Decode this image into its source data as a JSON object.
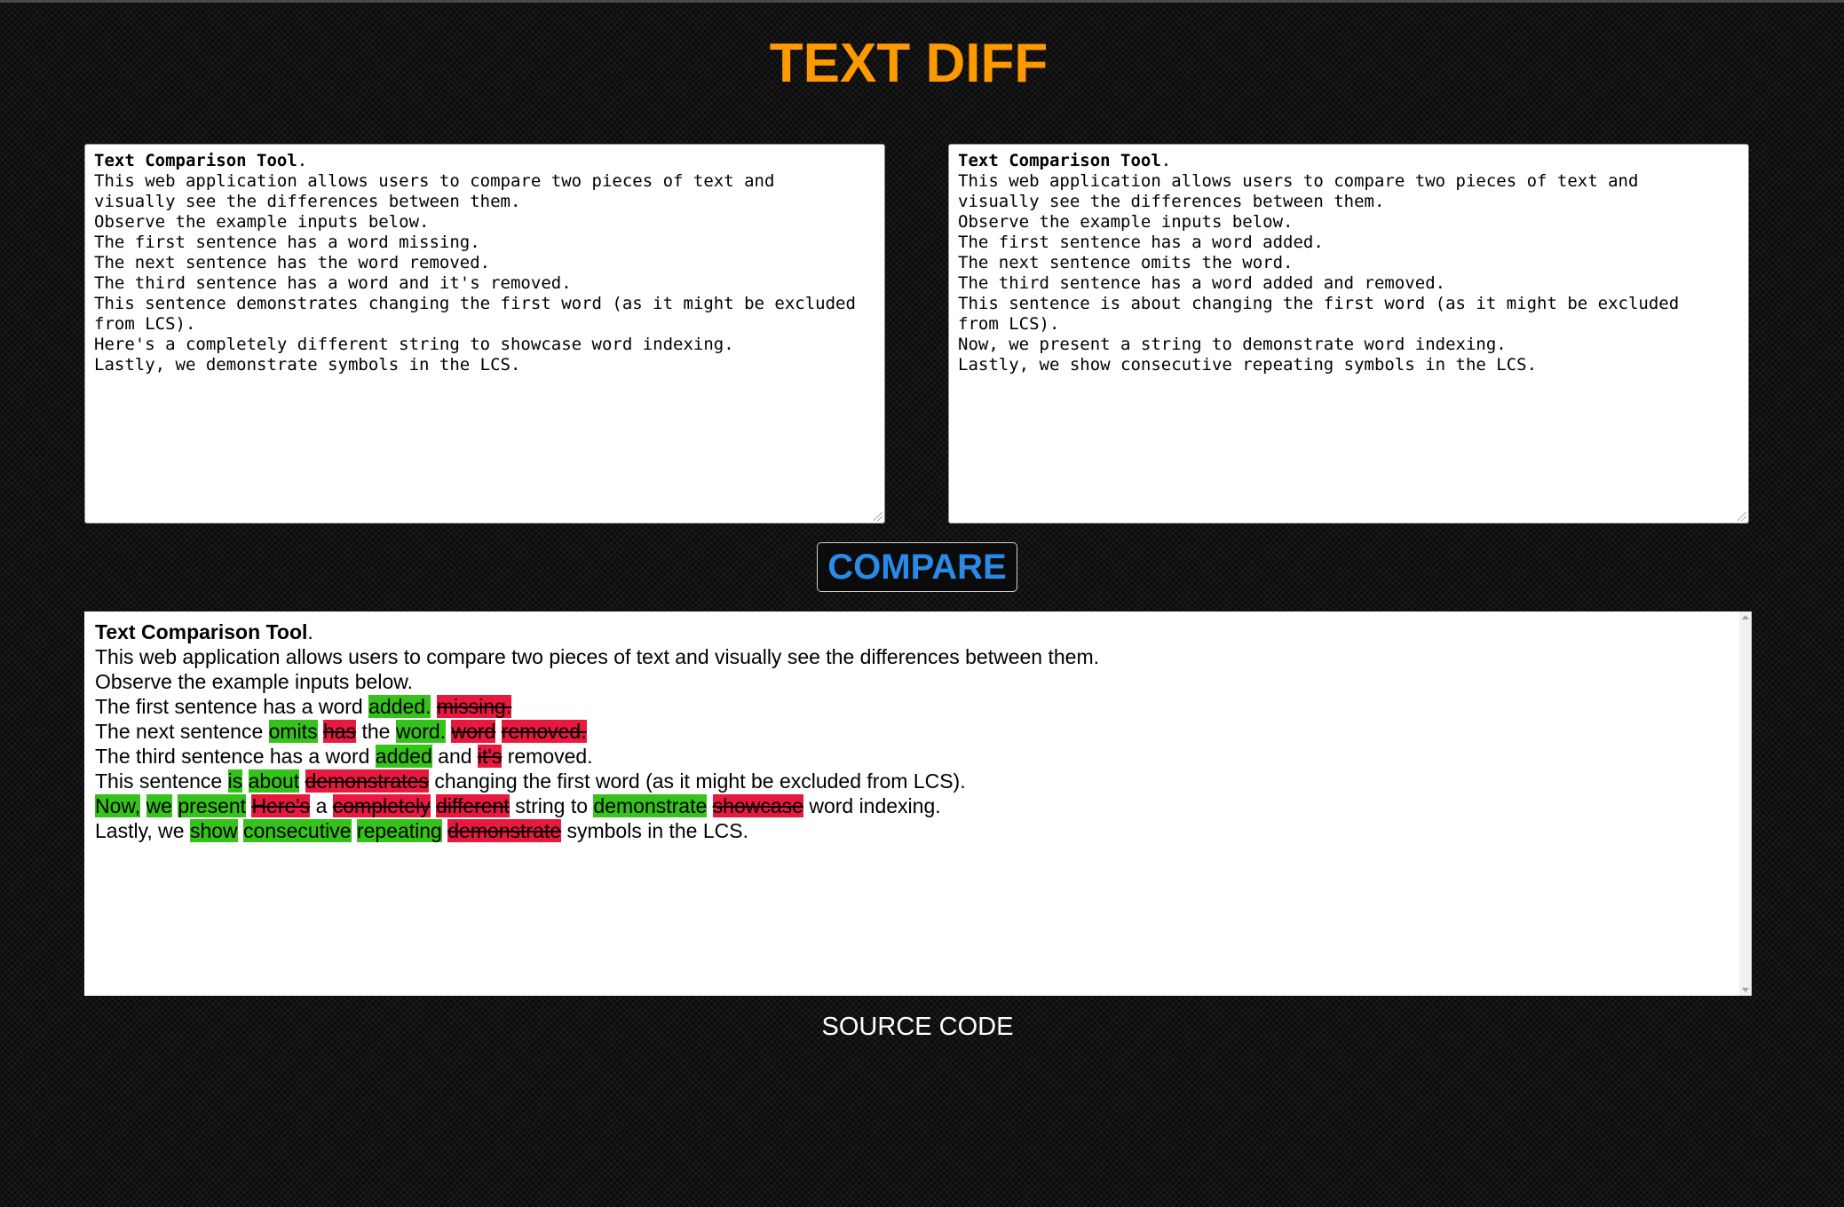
{
  "page": {
    "title": "TEXT DIFF",
    "compare_label": "COMPARE",
    "source_code_label": "SOURCE CODE"
  },
  "colors": {
    "title": "#ff9900",
    "compare": "#2a8ae8",
    "inserted": "#35c21a",
    "deleted": "#e8193f"
  },
  "left_input": {
    "heading": "Text Comparison Tool",
    "heading_suffix": ".",
    "body": "This web application allows users to compare two pieces of text and\nvisually see the differences between them.\nObserve the example inputs below.\nThe first sentence has a word missing.\nThe next sentence has the word removed.\nThe third sentence has a word and it's removed.\nThis sentence demonstrates changing the first word (as it might be excluded\nfrom LCS).\nHere's a completely different string to showcase word indexing.\nLastly, we demonstrate symbols in the LCS."
  },
  "right_input": {
    "heading": "Text Comparison Tool",
    "heading_suffix": ".",
    "body": "This web application allows users to compare two pieces of text and\nvisually see the differences between them.\nObserve the example inputs below.\nThe first sentence has a word added.\nThe next sentence omits the word.\nThe third sentence has a word added and removed.\nThis sentence is about changing the first word (as it might be excluded\nfrom LCS).\nNow, we present a string to demonstrate word indexing.\nLastly, we show consecutive repeating symbols in the LCS."
  },
  "result": {
    "heading": "Text Comparison Tool",
    "lines": [
      [
        {
          "t": "This web application allows users to compare two pieces of text and visually see the differences between them.",
          "k": "same"
        }
      ],
      [
        {
          "t": "Observe the example inputs below.",
          "k": "same"
        }
      ],
      [
        {
          "t": "The first sentence has a word",
          "k": "same"
        },
        {
          "t": "added.",
          "k": "ins"
        },
        {
          "t": "missing.",
          "k": "del"
        }
      ],
      [
        {
          "t": "The next sentence",
          "k": "same"
        },
        {
          "t": "omits",
          "k": "ins"
        },
        {
          "t": "has",
          "k": "del"
        },
        {
          "t": "the",
          "k": "same"
        },
        {
          "t": "word.",
          "k": "ins"
        },
        {
          "t": "word",
          "k": "del"
        },
        {
          "t": "removed.",
          "k": "del"
        }
      ],
      [
        {
          "t": "The third sentence has a word",
          "k": "same"
        },
        {
          "t": "added",
          "k": "ins"
        },
        {
          "t": "and",
          "k": "same"
        },
        {
          "t": "it's",
          "k": "del"
        },
        {
          "t": "removed.",
          "k": "same"
        }
      ],
      [
        {
          "t": "This sentence",
          "k": "same"
        },
        {
          "t": "is",
          "k": "ins"
        },
        {
          "t": "about",
          "k": "ins"
        },
        {
          "t": "demonstrates",
          "k": "del"
        },
        {
          "t": "changing the first word (as it might be excluded from LCS).",
          "k": "same"
        }
      ],
      [
        {
          "t": "Now,",
          "k": "ins"
        },
        {
          "t": "we",
          "k": "ins"
        },
        {
          "t": "present",
          "k": "ins"
        },
        {
          "t": "Here's",
          "k": "del"
        },
        {
          "t": "a",
          "k": "same"
        },
        {
          "t": "completely",
          "k": "del"
        },
        {
          "t": "different",
          "k": "del"
        },
        {
          "t": "string to",
          "k": "same"
        },
        {
          "t": "demonstrate",
          "k": "ins"
        },
        {
          "t": "showcase",
          "k": "del"
        },
        {
          "t": "word indexing.",
          "k": "same"
        }
      ],
      [
        {
          "t": "Lastly, we",
          "k": "same"
        },
        {
          "t": "show",
          "k": "ins"
        },
        {
          "t": "consecutive",
          "k": "ins"
        },
        {
          "t": "repeating",
          "k": "ins"
        },
        {
          "t": "demonstrate",
          "k": "del"
        },
        {
          "t": "symbols in the LCS.",
          "k": "same"
        }
      ]
    ]
  }
}
